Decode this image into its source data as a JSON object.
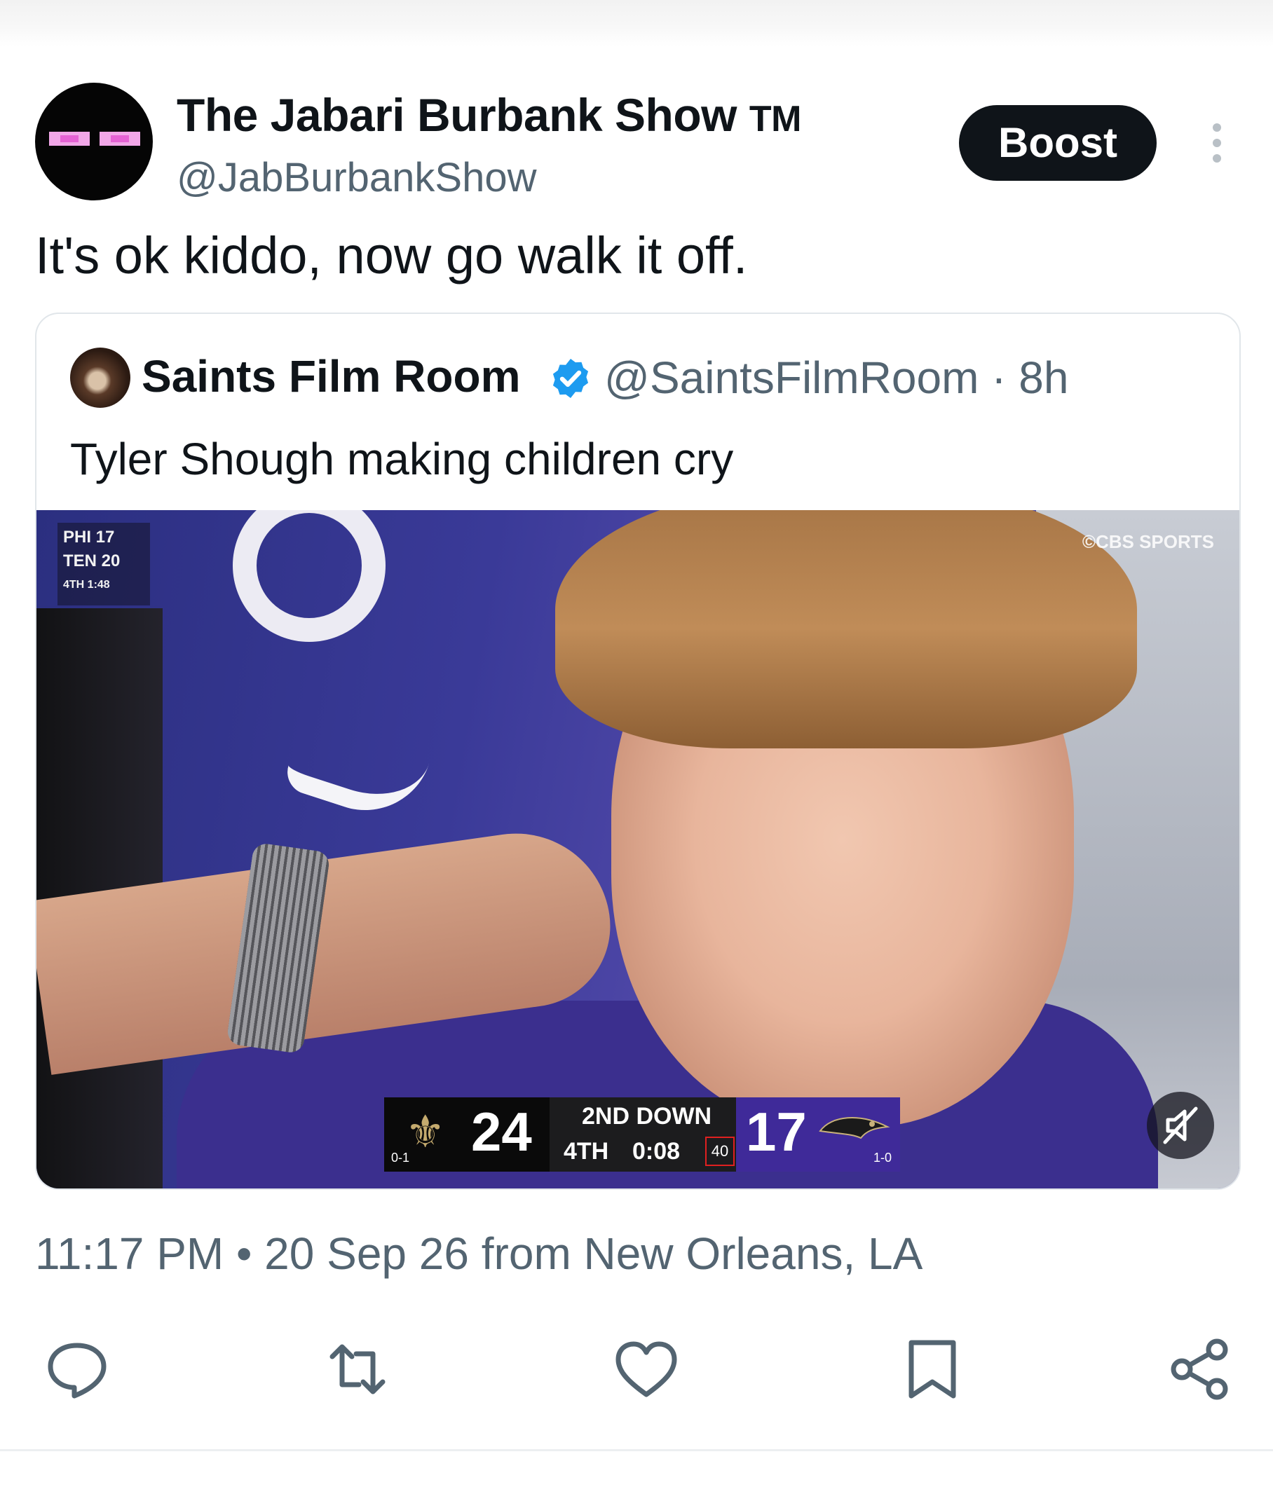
{
  "author": {
    "name": "The Jabari Burbank Show",
    "trademark": "TM",
    "handle": "@JabBurbankShow"
  },
  "boost_label": "Boost",
  "tweet_text": "It's ok kiddo, now go walk it off.",
  "quoted": {
    "name": "Saints Film Room",
    "handle_time": "@SaintsFilmRoom · 8h",
    "text": "Tyler Shough making children cry",
    "media": {
      "mini_score": {
        "line1": "PHI  17",
        "line2": "TEN  20",
        "line3": "4TH   1:48"
      },
      "watermark": "©CBS SPORTS",
      "scorebug": {
        "home_score": "24",
        "home_record": "0-1",
        "down": "2ND DOWN",
        "quarter": "4TH",
        "clock": "0:08",
        "play_clock": "40",
        "away_score": "17",
        "away_record": "1-0"
      }
    }
  },
  "meta": "11:17 PM • 20 Sep 26 from New Orleans, LA",
  "actions": [
    "reply-icon",
    "repost-icon",
    "like-icon",
    "bookmark-icon",
    "share-icon"
  ],
  "colors": {
    "text": "#0f1419",
    "secondary": "#536471",
    "verified": "#1d9bf0",
    "action_icon": "#536471"
  }
}
